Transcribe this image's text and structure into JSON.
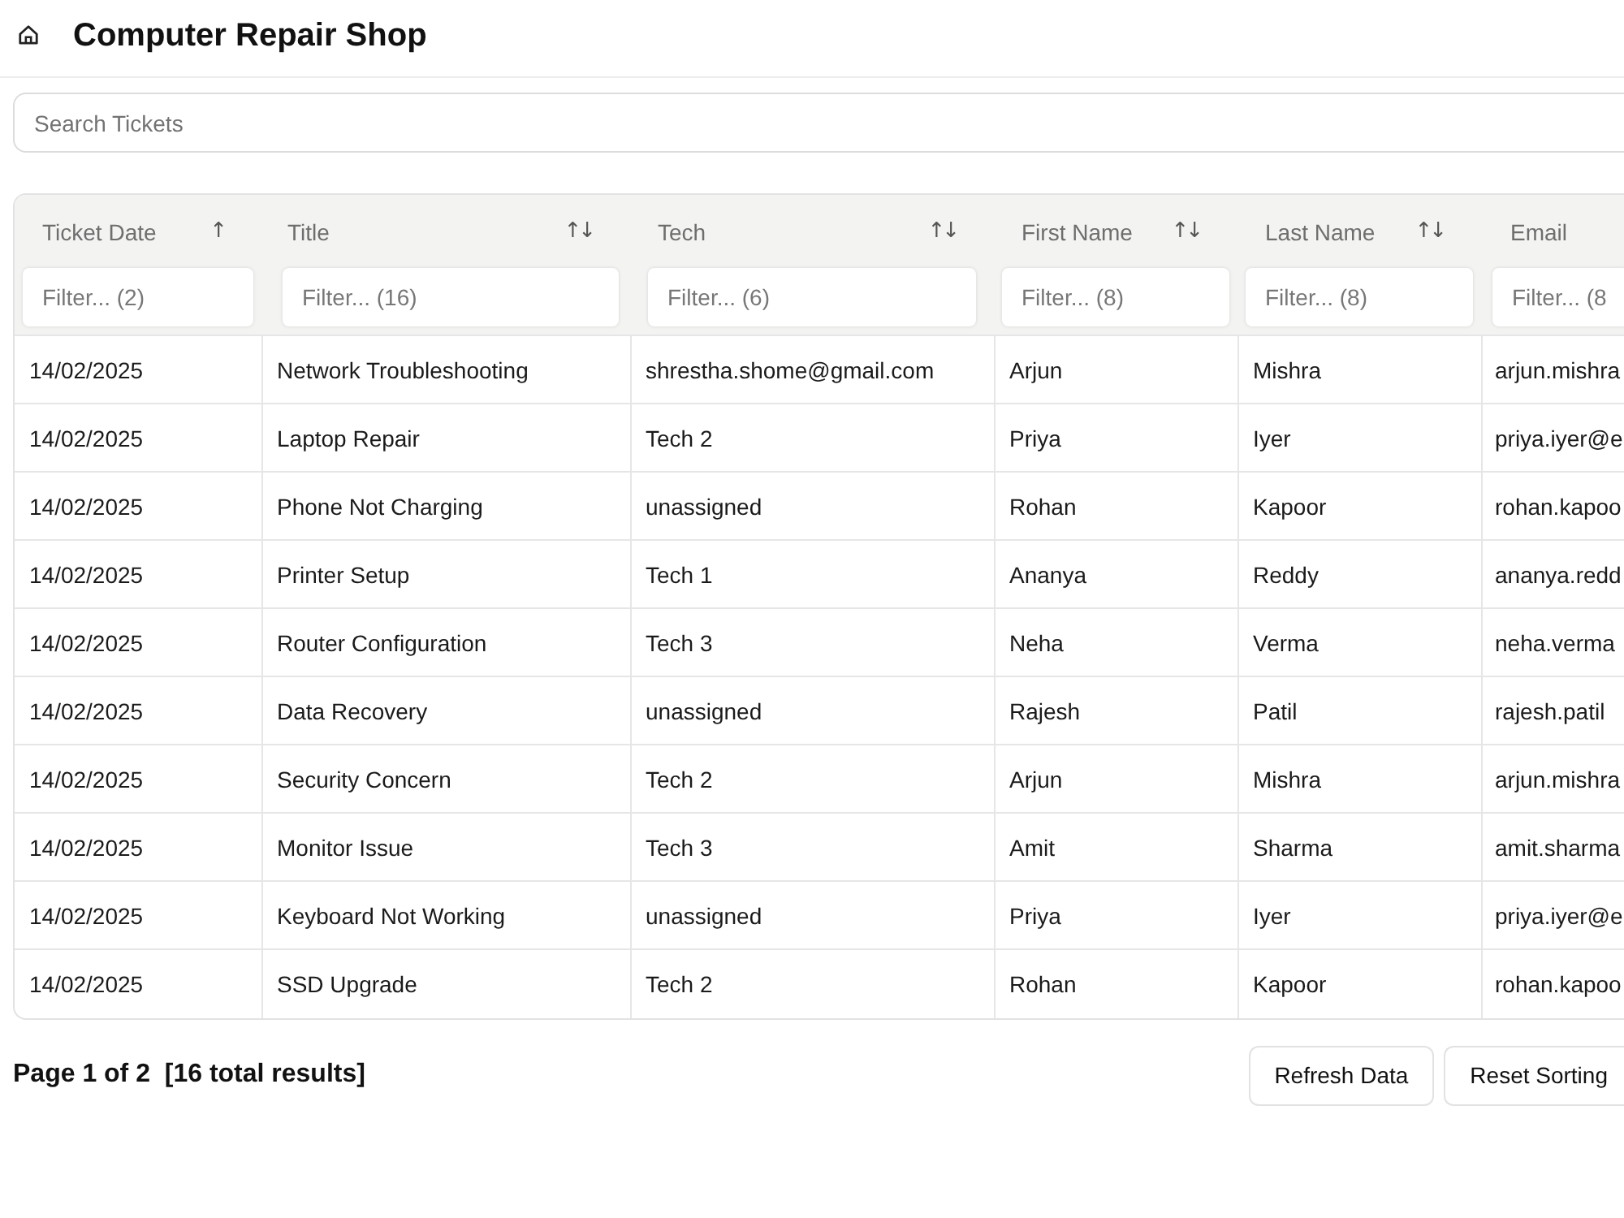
{
  "header": {
    "title": "Computer Repair Shop"
  },
  "search": {
    "placeholder": "Search Tickets"
  },
  "table": {
    "columns": [
      {
        "label": "Ticket Date",
        "sort_indicator": "↑",
        "filter_placeholder": "Filter... (2)"
      },
      {
        "label": "Title",
        "sort_indicator": "↑↓",
        "filter_placeholder": "Filter... (16)"
      },
      {
        "label": "Tech",
        "sort_indicator": "↑↓",
        "filter_placeholder": "Filter... (6)"
      },
      {
        "label": "First Name",
        "sort_indicator": "↑↓",
        "filter_placeholder": "Filter... (8)"
      },
      {
        "label": "Last Name",
        "sort_indicator": "↑↓",
        "filter_placeholder": "Filter... (8)"
      },
      {
        "label": "Email",
        "filter_placeholder": "Filter... (8"
      }
    ],
    "rows": [
      [
        "14/02/2025",
        "Network Troubleshooting",
        "shrestha.shome@gmail.com",
        "Arjun",
        "Mishra",
        "arjun.mishra"
      ],
      [
        "14/02/2025",
        "Laptop Repair",
        "Tech 2",
        "Priya",
        "Iyer",
        "priya.iyer@e"
      ],
      [
        "14/02/2025",
        "Phone Not Charging",
        "unassigned",
        "Rohan",
        "Kapoor",
        "rohan.kapoo"
      ],
      [
        "14/02/2025",
        "Printer Setup",
        "Tech 1",
        "Ananya",
        "Reddy",
        "ananya.redd"
      ],
      [
        "14/02/2025",
        "Router Configuration",
        "Tech 3",
        "Neha",
        "Verma",
        "neha.verma"
      ],
      [
        "14/02/2025",
        "Data Recovery",
        "unassigned",
        "Rajesh",
        "Patil",
        "rajesh.patil"
      ],
      [
        "14/02/2025",
        "Security Concern",
        "Tech 2",
        "Arjun",
        "Mishra",
        "arjun.mishra"
      ],
      [
        "14/02/2025",
        "Monitor Issue",
        "Tech 3",
        "Amit",
        "Sharma",
        "amit.sharma"
      ],
      [
        "14/02/2025",
        "Keyboard Not Working",
        "unassigned",
        "Priya",
        "Iyer",
        "priya.iyer@e"
      ],
      [
        "14/02/2025",
        "SSD Upgrade",
        "Tech 2",
        "Rohan",
        "Kapoor",
        "rohan.kapoo"
      ]
    ]
  },
  "footer": {
    "pagination": "Page 1 of 2  [16 total results]",
    "buttons": [
      "Refresh Data",
      "Reset Sorting"
    ]
  }
}
